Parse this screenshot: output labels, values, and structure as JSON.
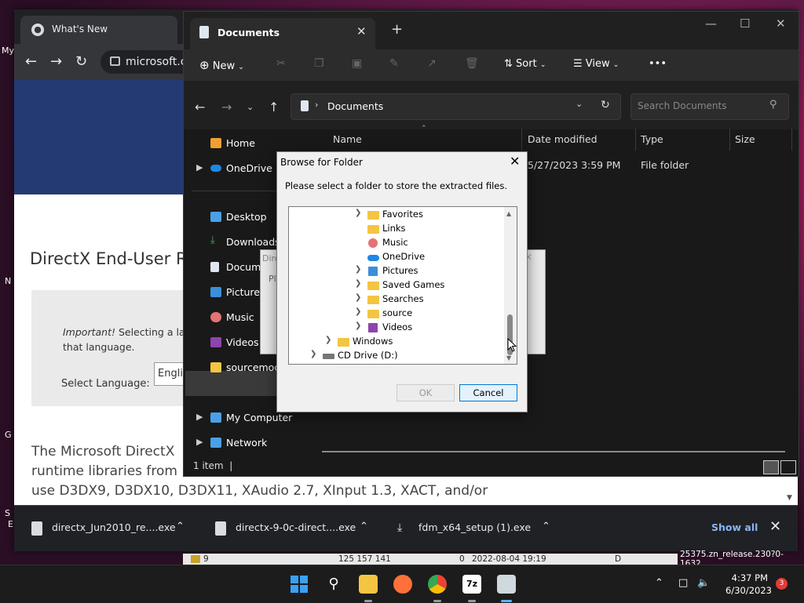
{
  "chrome": {
    "tab_title": "What's New",
    "omnibox_text": "microsoft.co",
    "page_title": "DirectX End-User Ru",
    "important_label": "Important!",
    "important_text": " Selecting a lang",
    "important_text2": "that language.",
    "select_language_label": "Select Language:",
    "select_language_value": "Englis",
    "description": "The Microsoft DirectX runtime libraries from ... use D3DX9, D3DX10, D3DX11, XAudio 2.7, XInput 1.3, XACT, and/or",
    "description_line1": "The Microsoft DirectX",
    "description_line2": "runtime libraries from",
    "description_line3": "use D3DX9, D3DX10, D3DX11, XAudio 2.7, XInput 1.3, XACT, and/or",
    "downloads": [
      {
        "name": "directx_Jun2010_re....exe"
      },
      {
        "name": "directx-9-0c-direct....exe"
      },
      {
        "name": "fdm_x64_setup (1).exe"
      }
    ],
    "show_all": "Show all"
  },
  "desktop_fragments": [
    "My",
    "N",
    "G",
    "S",
    "E"
  ],
  "explorer": {
    "tab_title": "Documents",
    "cmd": {
      "new": "New",
      "sort": "Sort",
      "view": "View",
      "more": "•••"
    },
    "address": "Documents",
    "search_placeholder": "Search Documents",
    "nav": {
      "home": "Home",
      "onedrive": "OneDrive",
      "desktop": "Desktop",
      "downloads": "Downloads",
      "documents": "Docume",
      "pictures": "Pictures",
      "music": "Music",
      "videos": "Videos",
      "sourcemods": "sourcemods",
      "mycomputer": "My Computer",
      "network": "Network"
    },
    "columns": {
      "name": "Name",
      "date": "Date modified",
      "type": "Type",
      "size": "Size"
    },
    "row": {
      "date": "5/27/2023 3:59 PM",
      "type": "File folder"
    },
    "status": "1 item"
  },
  "ghost_dialog": {
    "title": "Dire",
    "text": "Ple"
  },
  "browse_dialog": {
    "title": "Browse for Folder",
    "message": "Please select a folder to store the extracted files.",
    "tree": [
      {
        "label": "Favorites",
        "icon": "folder"
      },
      {
        "label": "Links",
        "icon": "folder"
      },
      {
        "label": "Music",
        "icon": "music"
      },
      {
        "label": "OneDrive",
        "icon": "cloud"
      },
      {
        "label": "Pictures",
        "icon": "pictures"
      },
      {
        "label": "Saved Games",
        "icon": "folder"
      },
      {
        "label": "Searches",
        "icon": "folder"
      },
      {
        "label": "source",
        "icon": "folder"
      },
      {
        "label": "Videos",
        "icon": "videos"
      },
      {
        "label": "Windows",
        "icon": "folder"
      },
      {
        "label": "CD Drive (D:)",
        "icon": "drive"
      }
    ],
    "ok": "OK",
    "cancel": "Cancel"
  },
  "bottom_strip": {
    "c1": "9",
    "c2": "125 157 141",
    "c3": "0",
    "c4": "2022-08-04 19:19",
    "c5": "D"
  },
  "build_text": "25375.zn_release.230?0-1632",
  "taskbar": {
    "time": "4:37 PM",
    "date": "6/30/2023",
    "badge": "3",
    "app_7z": "7z"
  },
  "colors": {
    "accent": "#0078d4",
    "folder": "#f4c542",
    "onedrive": "#1e88e5"
  }
}
